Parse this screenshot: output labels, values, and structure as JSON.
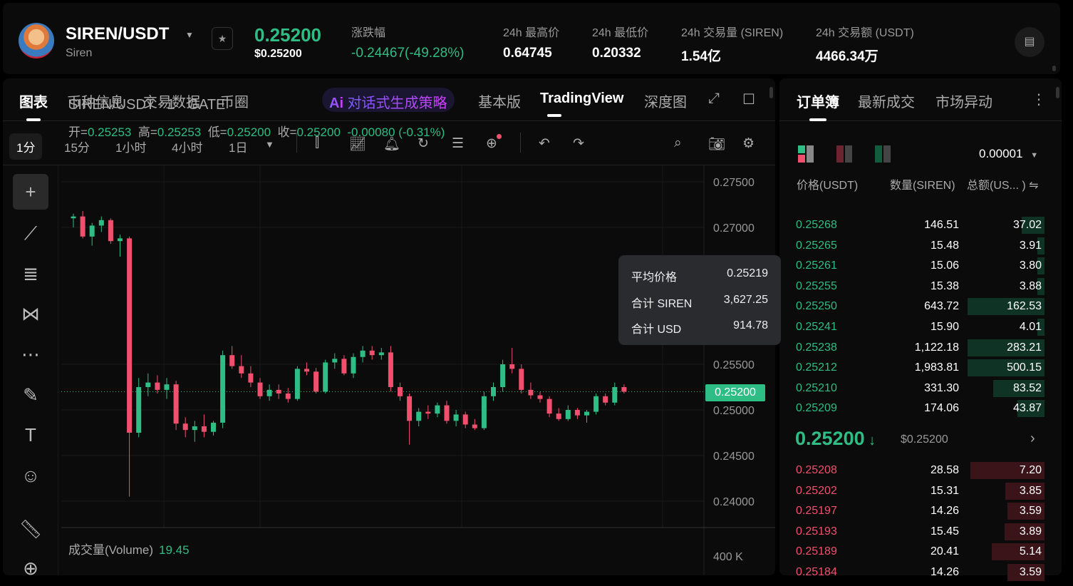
{
  "header": {
    "pair": "SIREN/USDT",
    "name": "Siren",
    "price": "0.25200",
    "price_usd": "$0.25200",
    "stats": [
      {
        "label": "涨跌幅",
        "value": "-0.24467(-49.28%)",
        "color": "#2ebd85"
      },
      {
        "label": "24h 最高价",
        "value": "0.64745"
      },
      {
        "label": "24h 最低价",
        "value": "0.20332"
      },
      {
        "label": "24h 交易量 (SIREN)",
        "value": "1.54亿"
      },
      {
        "label": "24h 交易额 (USDT)",
        "value": "4466.34万"
      }
    ]
  },
  "chart_tabs": [
    "图表",
    "币种信息",
    "交易数据",
    "币圈"
  ],
  "ai_button": "对话式生成策略",
  "ai_icon": "Ai",
  "view_tabs": [
    "基本版",
    "TradingView",
    "深度图"
  ],
  "intervals": [
    "1分",
    "15分",
    "1小时",
    "4小时",
    "1日"
  ],
  "legend": {
    "title": "SIREN/USDT · 1 · GATE",
    "open_label": "开=",
    "open": "0.25253",
    "high_label": "高=",
    "high": "0.25253",
    "low_label": "低=",
    "low": "0.25200",
    "close_label": "收=",
    "close": "0.25200",
    "change": "-0.00080 (-0.31%)"
  },
  "tooltip": [
    {
      "label": "平均价格",
      "value": "0.25219"
    },
    {
      "label": "合计 SIREN",
      "value": "3,627.25"
    },
    {
      "label": "合计 USD",
      "value": "914.78"
    }
  ],
  "volume": {
    "label": "成交量(Volume)",
    "value": "19.45",
    "axis": "400 K"
  },
  "chart_data": {
    "type": "candlestick",
    "y_ticks": [
      "0.27500",
      "0.27000",
      "0.25500",
      "0.25000",
      "0.24500",
      "0.24000"
    ],
    "ylim": [
      0.24,
      0.275
    ],
    "last_price": "0.25200",
    "candles": [
      [
        0.271,
        0.2715,
        0.27,
        0.2712
      ],
      [
        0.2712,
        0.2718,
        0.2688,
        0.269
      ],
      [
        0.269,
        0.2705,
        0.268,
        0.2702
      ],
      [
        0.2702,
        0.2712,
        0.2695,
        0.2708
      ],
      [
        0.2708,
        0.271,
        0.2682,
        0.2685
      ],
      [
        0.2685,
        0.2692,
        0.2668,
        0.2688
      ],
      [
        0.2688,
        0.269,
        0.2405,
        0.2475
      ],
      [
        0.2475,
        0.2535,
        0.247,
        0.2525
      ],
      [
        0.2525,
        0.254,
        0.2515,
        0.253
      ],
      [
        0.253,
        0.2538,
        0.2518,
        0.2522
      ],
      [
        0.2522,
        0.2535,
        0.2512,
        0.2528
      ],
      [
        0.2528,
        0.2532,
        0.2478,
        0.2485
      ],
      [
        0.2485,
        0.2492,
        0.247,
        0.2478
      ],
      [
        0.2478,
        0.2488,
        0.2465,
        0.2482
      ],
      [
        0.2482,
        0.2495,
        0.247,
        0.2476
      ],
      [
        0.2476,
        0.2488,
        0.2472,
        0.2486
      ],
      [
        0.2486,
        0.2565,
        0.248,
        0.256
      ],
      [
        0.256,
        0.257,
        0.2545,
        0.2548
      ],
      [
        0.2548,
        0.256,
        0.2535,
        0.254
      ],
      [
        0.254,
        0.2548,
        0.2525,
        0.253
      ],
      [
        0.253,
        0.2535,
        0.2512,
        0.2515
      ],
      [
        0.2515,
        0.2528,
        0.251,
        0.2522
      ],
      [
        0.2522,
        0.2528,
        0.2512,
        0.2518
      ],
      [
        0.2518,
        0.2524,
        0.2508,
        0.2512
      ],
      [
        0.2512,
        0.2548,
        0.251,
        0.2545
      ],
      [
        0.2545,
        0.2552,
        0.2538,
        0.2542
      ],
      [
        0.2542,
        0.2546,
        0.2518,
        0.252
      ],
      [
        0.252,
        0.2555,
        0.2518,
        0.2552
      ],
      [
        0.2552,
        0.2562,
        0.2545,
        0.2556
      ],
      [
        0.2556,
        0.256,
        0.2538,
        0.254
      ],
      [
        0.254,
        0.2562,
        0.2535,
        0.2558
      ],
      [
        0.2558,
        0.257,
        0.2552,
        0.2565
      ],
      [
        0.2565,
        0.257,
        0.2555,
        0.256
      ],
      [
        0.256,
        0.2568,
        0.2555,
        0.2563
      ],
      [
        0.2563,
        0.257,
        0.252,
        0.2525
      ],
      [
        0.2525,
        0.253,
        0.251,
        0.2515
      ],
      [
        0.2515,
        0.2518,
        0.2462,
        0.2488
      ],
      [
        0.2488,
        0.2502,
        0.2482,
        0.2498
      ],
      [
        0.2498,
        0.2505,
        0.249,
        0.2496
      ],
      [
        0.2496,
        0.2508,
        0.2492,
        0.2505
      ],
      [
        0.2505,
        0.251,
        0.2485,
        0.2488
      ],
      [
        0.2488,
        0.25,
        0.2482,
        0.2495
      ],
      [
        0.2495,
        0.2498,
        0.248,
        0.2484
      ],
      [
        0.2484,
        0.249,
        0.2478,
        0.248
      ],
      [
        0.248,
        0.252,
        0.2478,
        0.2515
      ],
      [
        0.2515,
        0.253,
        0.251,
        0.2525
      ],
      [
        0.2525,
        0.2555,
        0.252,
        0.255
      ],
      [
        0.255,
        0.2568,
        0.254,
        0.2545
      ],
      [
        0.2545,
        0.255,
        0.2518,
        0.2522
      ],
      [
        0.2522,
        0.253,
        0.2512,
        0.2516
      ],
      [
        0.2516,
        0.252,
        0.2508,
        0.2512
      ],
      [
        0.2512,
        0.2515,
        0.2492,
        0.2496
      ],
      [
        0.2496,
        0.2502,
        0.2488,
        0.249
      ],
      [
        0.249,
        0.2505,
        0.2488,
        0.25
      ],
      [
        0.25,
        0.2502,
        0.249,
        0.2494
      ],
      [
        0.2494,
        0.25,
        0.2486,
        0.2498
      ],
      [
        0.2498,
        0.2518,
        0.2495,
        0.2515
      ],
      [
        0.2515,
        0.2518,
        0.2505,
        0.2508
      ],
      [
        0.2508,
        0.253,
        0.2505,
        0.2525
      ],
      [
        0.2525,
        0.2528,
        0.2518,
        0.252
      ]
    ]
  },
  "book": {
    "tabs": [
      "订单簿",
      "最新成交",
      "市场异动"
    ],
    "precision": "0.00001",
    "headers": [
      "价格(USDT)",
      "数量(SIREN)",
      "总额(US... )"
    ],
    "asks": [
      [
        "0.25268",
        "146.51",
        "37.02"
      ],
      [
        "0.25265",
        "15.48",
        "3.91"
      ],
      [
        "0.25261",
        "15.06",
        "3.80"
      ],
      [
        "0.25255",
        "15.38",
        "3.88"
      ],
      [
        "0.25250",
        "643.72",
        "162.53"
      ],
      [
        "0.25241",
        "15.90",
        "4.01"
      ],
      [
        "0.25238",
        "1,122.18",
        "283.21"
      ],
      [
        "0.25212",
        "1,983.81",
        "500.15"
      ],
      [
        "0.25210",
        "331.30",
        "83.52"
      ],
      [
        "0.25209",
        "174.06",
        "43.87"
      ]
    ],
    "mid": "0.25200",
    "mid_usd": "$0.25200",
    "bids": [
      [
        "0.25208",
        "28.58",
        "7.20"
      ],
      [
        "0.25202",
        "15.31",
        "3.85"
      ],
      [
        "0.25197",
        "14.26",
        "3.59"
      ],
      [
        "0.25193",
        "15.45",
        "3.89"
      ],
      [
        "0.25189",
        "20.41",
        "5.14"
      ],
      [
        "0.25184",
        "14.26",
        "3.59"
      ]
    ]
  },
  "colors": {
    "up": "#2ebd85",
    "down": "#f0506e",
    "bg": "#0b0b0b"
  }
}
